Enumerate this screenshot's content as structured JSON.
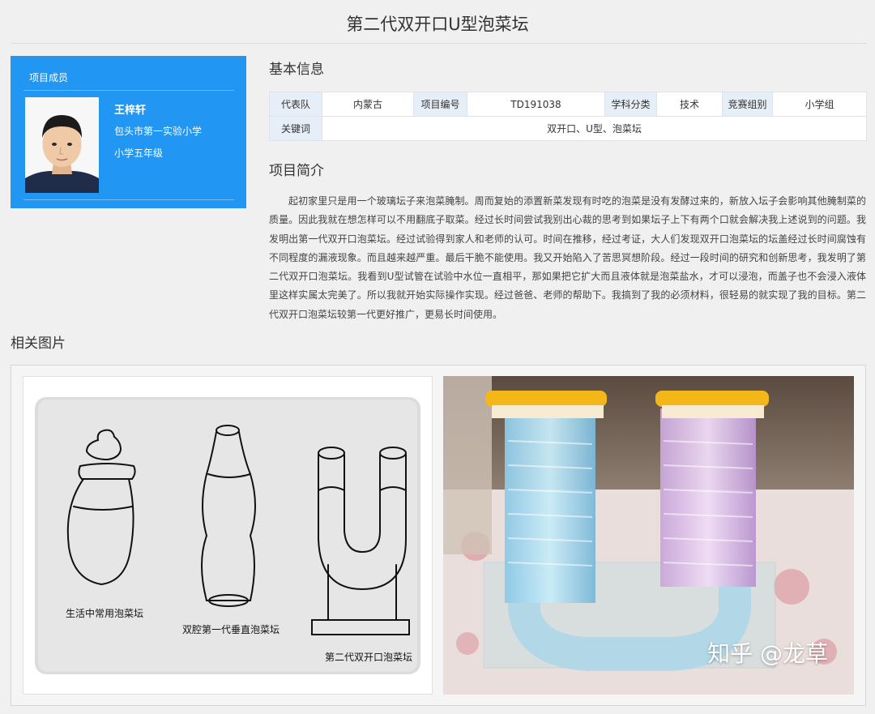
{
  "title": "第二代双开口U型泡菜坛",
  "member": {
    "section_label": "项目成员",
    "name": "王梓轩",
    "school": "包头市第一实验小学",
    "grade": "小学五年级"
  },
  "basic_info": {
    "heading": "基本信息",
    "row1": [
      {
        "label": "代表队",
        "value": "内蒙古"
      },
      {
        "label": "项目编号",
        "value": "TD191038"
      },
      {
        "label": "学科分类",
        "value": "技术"
      },
      {
        "label": "竞赛组别",
        "value": "小学组"
      }
    ],
    "keywords_label": "关键词",
    "keywords_value": "双开口、U型、泡菜坛"
  },
  "intro": {
    "heading": "项目简介",
    "text": "起初家里只是用一个玻璃坛子来泡菜腌制。周而复始的添置新菜发现有时吃的泡菜是没有发酵过来的，新放入坛子会影响其他腌制菜的质量。因此我就在想怎样可以不用翻底子取菜。经过长时间尝试我别出心裁的思考到如果坛子上下有两个口就会解决我上述说到的问题。我发明出第一代双开口泡菜坛。经过试验得到家人和老师的认可。时间在推移，经过考证，大人们发现双开口泡菜坛的坛盖经过长时间腐蚀有不同程度的漏液现象。而且越来越严重。最后干脆不能使用。我又开始陷入了苦思冥想阶段。经过一段时间的研究和创新思考，我发明了第二代双开口泡菜坛。我看到U型试管在试验中水位一直相平，那如果把它扩大而且液体就是泡菜盐水，才可以浸泡，而盖子也不会浸入液体里这样实属太完美了。所以我就开始实际操作实现。经过爸爸、老师的帮助下。我搞到了我的必须材料，很轻易的就实现了我的目标。第二代双开口泡菜坛较第一代更好推广，更易长时间使用。"
  },
  "images": {
    "heading": "相关图片",
    "sketch_captions": [
      "生活中常用泡菜坛",
      "双腔第一代垂直泡菜坛",
      "第二代双开口泡菜坛"
    ],
    "watermark": "知乎 @龙草"
  },
  "colors": {
    "card_blue": "#2196f3",
    "table_label_bg": "#e6eef7",
    "lid_orange": "#f4b71a"
  }
}
